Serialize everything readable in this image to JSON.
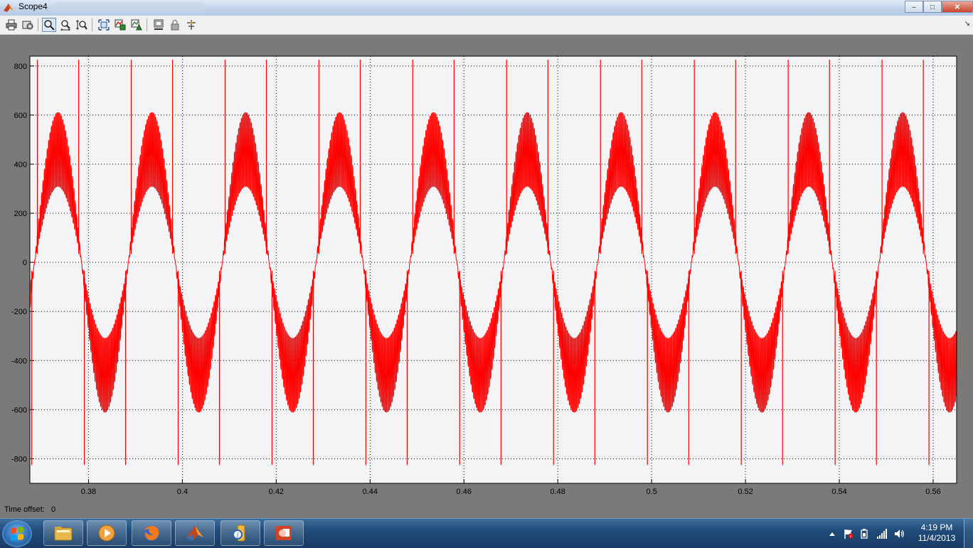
{
  "window": {
    "title": "Scope4",
    "controls": {
      "minimize": "–",
      "maximize": "□",
      "close": "✕"
    }
  },
  "toolbar": {
    "buttons": [
      {
        "name": "print-icon",
        "active": false
      },
      {
        "name": "parameters-icon",
        "active": false
      },
      {
        "name": "zoom-icon",
        "active": true
      },
      {
        "name": "zoom-x-icon",
        "active": false
      },
      {
        "name": "zoom-y-icon",
        "active": false
      },
      {
        "name": "autoscale-icon",
        "active": false
      },
      {
        "name": "save-axes-icon",
        "active": false
      },
      {
        "name": "restore-axes-icon",
        "active": false
      },
      {
        "name": "floating-scope-icon",
        "active": false
      },
      {
        "name": "lock-icon",
        "active": false
      },
      {
        "name": "signal-selection-icon",
        "active": false
      }
    ],
    "corner_arrow": "↘"
  },
  "status": {
    "time_offset_label": "Time offset:",
    "time_offset_value": "0"
  },
  "colors": {
    "trace": "#ff0000",
    "plot_bg": "#f4f3f5",
    "frame_bg": "#7b7a78",
    "axis": "#000000"
  },
  "chart_data": {
    "type": "line",
    "xlim": [
      0.3675,
      0.565
    ],
    "ylim": [
      -900,
      840
    ],
    "xticks": [
      0.38,
      0.4,
      0.42,
      0.44,
      0.46,
      0.48,
      0.5,
      0.52,
      0.54,
      0.56
    ],
    "xtick_labels": [
      "0.38",
      "0.4",
      "0.42",
      "0.44",
      "0.46",
      "0.48",
      "0.5",
      "0.52",
      "0.54",
      "0.56"
    ],
    "yticks": [
      -800,
      -600,
      -400,
      -200,
      0,
      200,
      400,
      600,
      800
    ],
    "ytick_labels": [
      "-800",
      "-600",
      "-400",
      "-200",
      "0",
      "200",
      "400",
      "600",
      "800"
    ],
    "grid": true,
    "series": [
      {
        "color": "#ff0000",
        "waveform": "distorted sinusoid with switching ripple",
        "period": 0.02,
        "envelope_max": 610,
        "envelope_min": -610,
        "baseline_peak": 310,
        "spike_peak": 825,
        "spike_trough": -825,
        "positive_peak_times": [
          0.3735,
          0.3935,
          0.4135,
          0.4335,
          0.4535,
          0.4735,
          0.4935,
          0.5135,
          0.5335,
          0.5535
        ],
        "negative_peak_times": [
          0.3835,
          0.4035,
          0.4235,
          0.4435,
          0.4635,
          0.4835,
          0.5035,
          0.5235,
          0.5435,
          0.5635
        ]
      }
    ]
  },
  "taskbar": {
    "items": [
      "windows-explorer-icon",
      "media-player-icon",
      "firefox-icon",
      "matlab-icon",
      "help-icon",
      "powerpoint-icon"
    ],
    "clock_time": "4:19 PM",
    "clock_date": "11/4/2013"
  }
}
